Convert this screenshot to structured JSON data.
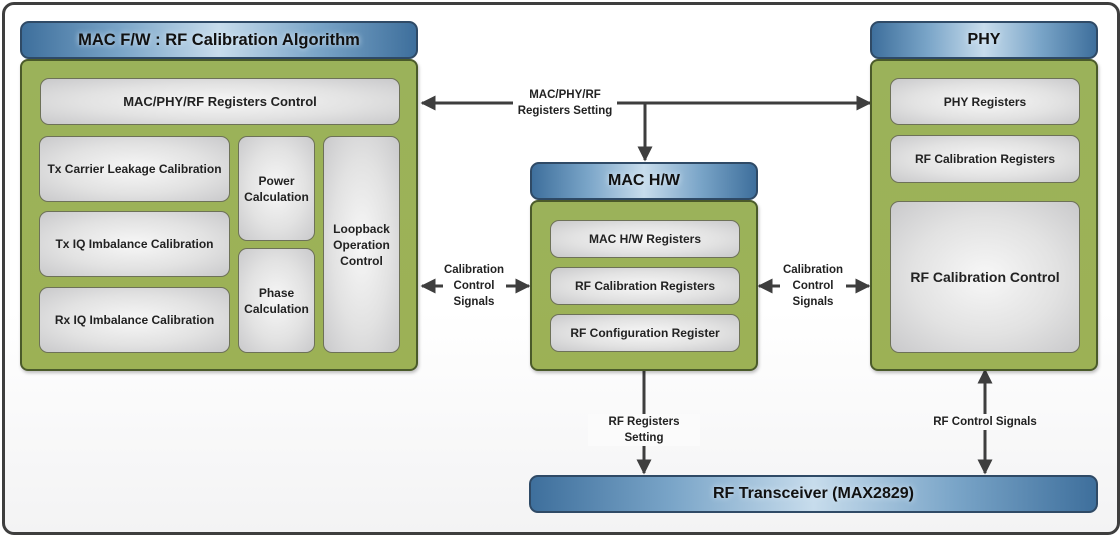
{
  "mac_fw": {
    "title": "MAC F/W : RF Calibration Algorithm",
    "registers_control": "MAC/PHY/RF Registers Control",
    "tx_carrier_leakage": "Tx Carrier Leakage Calibration",
    "tx_iq_imbalance": "Tx IQ Imbalance Calibration",
    "rx_iq_imbalance": "Rx IQ Imbalance Calibration",
    "power_calc_line1": "Power",
    "power_calc_line2": "Calculation",
    "phase_calc_line1": "Phase",
    "phase_calc_line2": "Calculation",
    "loopback_line1": "Loopback",
    "loopback_line2": "Operation",
    "loopback_line3": "Control"
  },
  "mac_hw": {
    "title": "MAC H/W",
    "registers": "MAC H/W Registers",
    "rf_calibration_registers": "RF Calibration Registers",
    "rf_configuration_register": "RF Configuration Register"
  },
  "phy": {
    "title": "PHY",
    "registers": "PHY Registers",
    "rf_calibration_registers": "RF Calibration Registers",
    "rf_calibration_control": "RF Calibration Control"
  },
  "rf_transceiver": {
    "title": "RF Transceiver (MAX2829)"
  },
  "connections": {
    "registers_setting_line1": "MAC/PHY/RF",
    "registers_setting_line2": "Registers Setting",
    "cal_left_line1": "Calibration",
    "cal_left_line2": "Control",
    "cal_left_line3": "Signals",
    "cal_right_line1": "Calibration",
    "cal_right_line2": "Control",
    "cal_right_line3": "Signals",
    "rf_registers_setting": "RF Registers Setting",
    "rf_control_signals": "RF Control Signals"
  },
  "colors": {
    "header_blue": "#3e6f9c",
    "panel_green": "#9bb25a",
    "box_gray": "#e2e2e2",
    "arrow": "#3e3e3e"
  }
}
